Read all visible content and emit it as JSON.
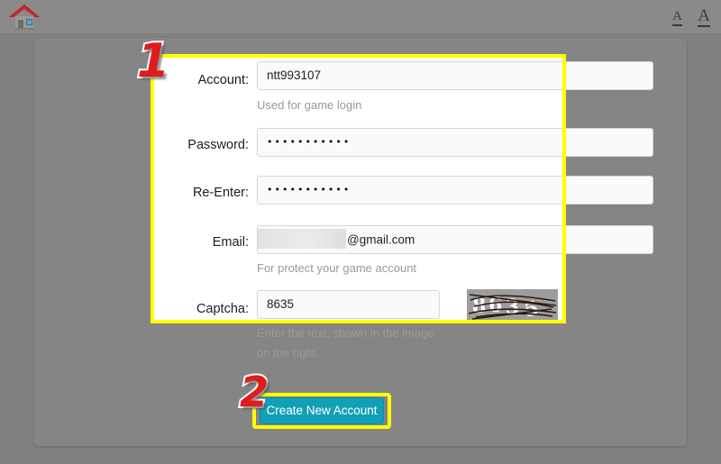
{
  "header": {
    "home_icon": "home-icon",
    "font_small_label": "A",
    "font_large_label": "A"
  },
  "form": {
    "fields": [
      {
        "label": "Account:",
        "value": "ntt993107",
        "hint": "Used for game login",
        "type": "text"
      },
      {
        "label": "Password:",
        "value": "•••••••••••",
        "hint": "",
        "type": "password"
      },
      {
        "label": "Re-Enter:",
        "value": "•••••••••••",
        "hint": "",
        "type": "password"
      },
      {
        "label": "Email:",
        "value": "@gmail.com",
        "hint": "For protect your game account",
        "type": "email"
      },
      {
        "label": "Captcha:",
        "value": "8635",
        "hint": "Enter the text, shown in the image",
        "hint2": "on the right.",
        "type": "text"
      }
    ],
    "captcha_image_text": "8635"
  },
  "actions": {
    "create_button_label": "Create New Account"
  },
  "annotations": {
    "step_one": "1",
    "step_two": "2"
  },
  "colors": {
    "page_background": "#808080",
    "header_background": "#8a8a8a",
    "panel_background": "#858585",
    "form_background": "#ffffff",
    "highlight": "#ffff00",
    "button": "#12a0b8",
    "annotation": "#e01b1b",
    "hint_text": "#9a9a9a"
  }
}
